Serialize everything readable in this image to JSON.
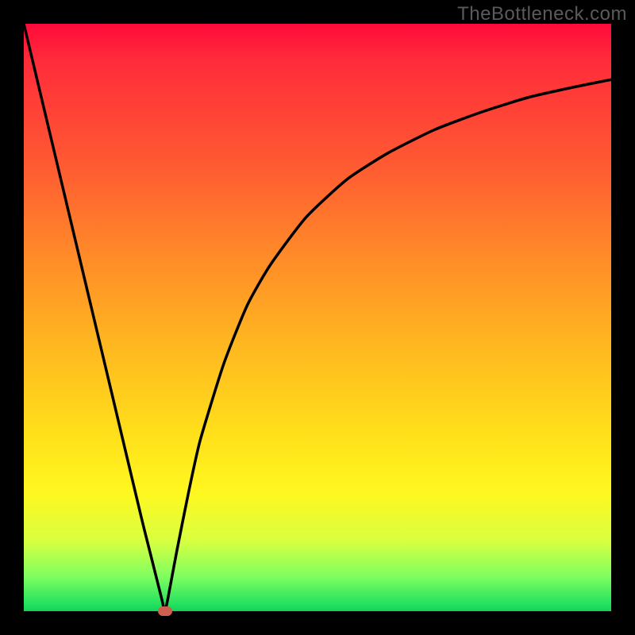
{
  "attribution": "TheBottleneck.com",
  "colors": {
    "frame": "#000000",
    "gradient_top": "#ff0a3a",
    "gradient_mid": "#ffe01a",
    "gradient_bottom": "#18d058",
    "curve": "#000000",
    "dot": "#cd5f4f"
  },
  "chart_data": {
    "type": "line",
    "title": "",
    "xlabel": "",
    "ylabel": "",
    "xlim": [
      0,
      100
    ],
    "ylim": [
      0,
      100
    ],
    "optimal_x": 24,
    "series": [
      {
        "name": "bottleneck-curve",
        "x": [
          0,
          5,
          10,
          15,
          20,
          22,
          23.5,
          24,
          24.5,
          26,
          28,
          30,
          34,
          38,
          42,
          48,
          55,
          62,
          70,
          78,
          86,
          94,
          100
        ],
        "y": [
          100,
          79,
          58,
          37,
          16,
          8,
          2,
          0,
          2,
          10,
          20,
          29,
          42,
          52,
          59,
          67,
          73.5,
          78,
          82,
          85,
          87.5,
          89.3,
          90.5
        ]
      }
    ],
    "annotations": [
      {
        "name": "optimal-point",
        "x": 24,
        "y": 0
      }
    ]
  }
}
